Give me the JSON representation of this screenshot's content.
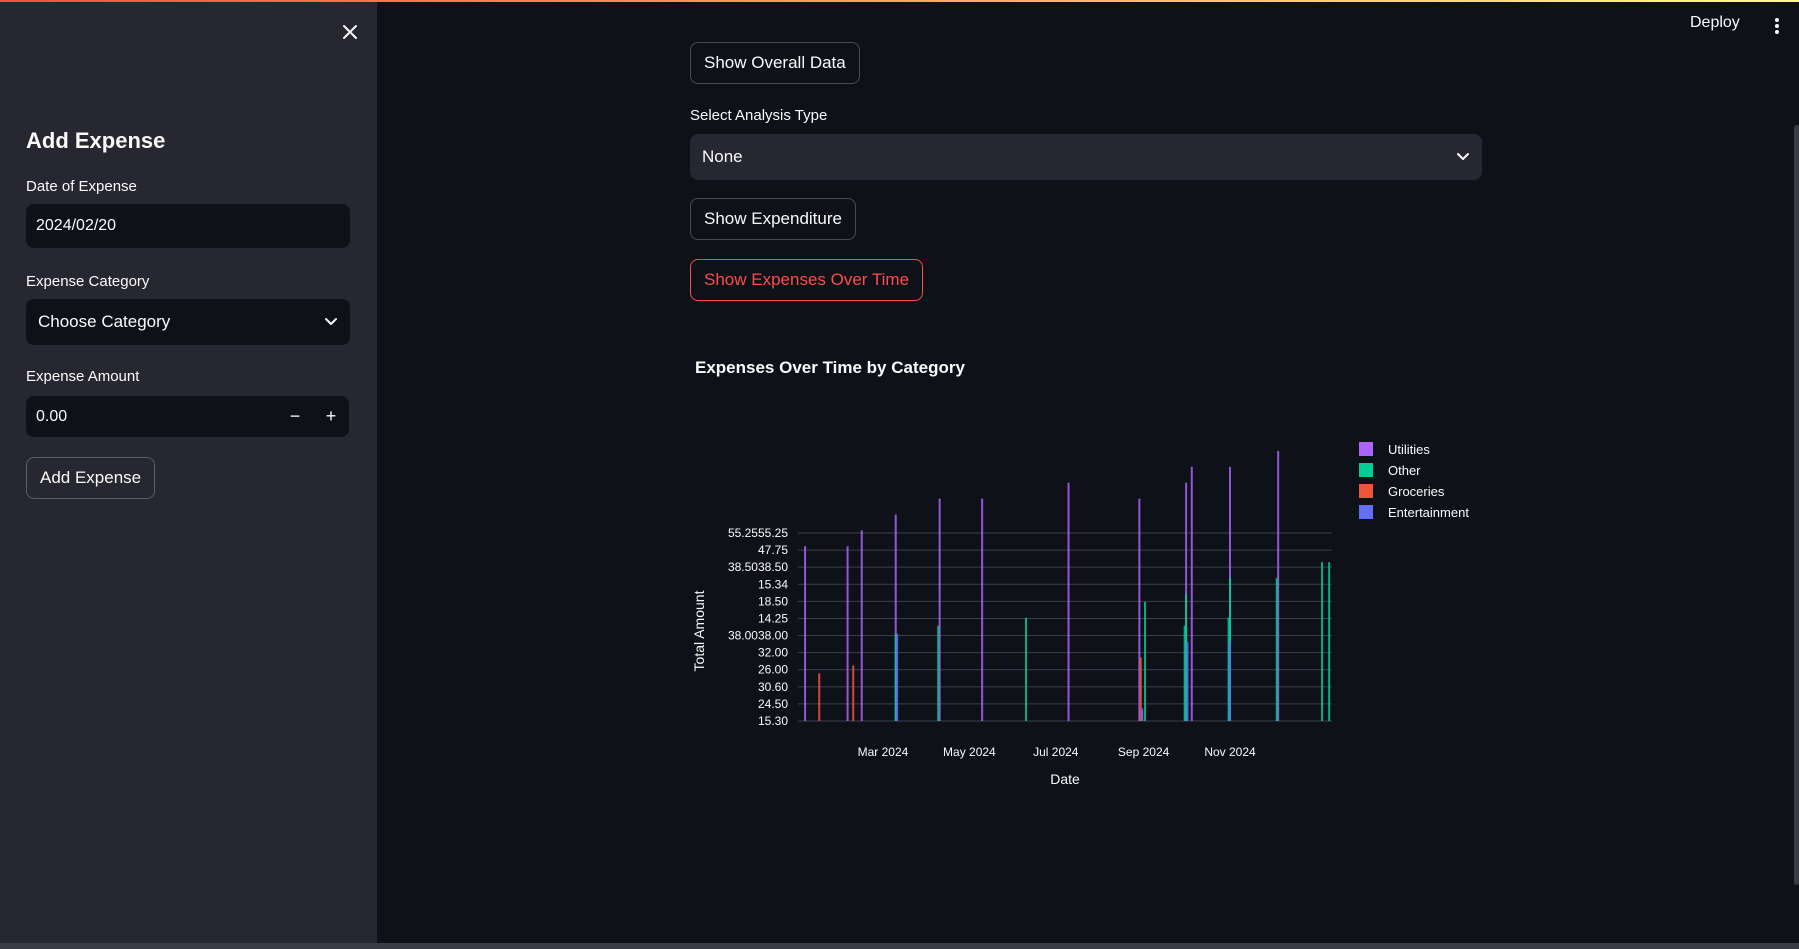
{
  "header": {
    "deploy_label": "Deploy"
  },
  "sidebar": {
    "title": "Add Expense",
    "date_label": "Date of Expense",
    "date_value": "2024/02/20",
    "category_label": "Expense Category",
    "category_value": "Choose Category",
    "amount_label": "Expense Amount",
    "amount_value": "0.00",
    "minus_label": "−",
    "plus_label": "+",
    "add_button_label": "Add Expense"
  },
  "main": {
    "show_overall_label": "Show Overall Data",
    "analysis_label": "Select Analysis Type",
    "analysis_value": "None",
    "show_expenditure_label": "Show Expenditure",
    "show_over_time_label": "Show Expenses Over Time"
  },
  "colors": {
    "accent": "#ff4b4b",
    "background": "#0e1117",
    "sidebar": "#262730",
    "utilities": "#ab63fa",
    "other": "#00cc96",
    "groceries": "#ef553b",
    "entertainment": "#636efa"
  },
  "chart_data": {
    "type": "bar",
    "title": "Expenses Over Time by Category",
    "xlabel": "Date",
    "ylabel": "Total Amount",
    "x_ticks": [
      "Mar 2024",
      "May 2024",
      "Jul 2024",
      "Sep 2024",
      "Nov 2024"
    ],
    "y_ticks": [
      "15.30",
      "24.50",
      "30.60",
      "26.00",
      "32.00",
      "38.0038.00",
      "14.25",
      "18.50",
      "15.34",
      "38.5038.50",
      "47.75",
      "55.2555.25"
    ],
    "legend_position": "right",
    "grid": true,
    "series": [
      {
        "name": "Utilities",
        "color": "#ab63fa",
        "points": [
          {
            "x": "2024-01-06",
            "y": 11
          },
          {
            "x": "2024-02-05",
            "y": 11
          },
          {
            "x": "2024-02-15",
            "y": 12
          },
          {
            "x": "2024-03-10",
            "y": 13
          },
          {
            "x": "2024-04-10",
            "y": 14
          },
          {
            "x": "2024-05-10",
            "y": 14
          },
          {
            "x": "2024-07-10",
            "y": 15
          },
          {
            "x": "2024-08-29",
            "y": 14
          },
          {
            "x": "2024-10-01",
            "y": 15
          },
          {
            "x": "2024-10-05",
            "y": 16
          },
          {
            "x": "2024-11-01",
            "y": 16
          },
          {
            "x": "2024-12-05",
            "y": 17
          }
        ]
      },
      {
        "name": "Other",
        "color": "#00cc96",
        "points": [
          {
            "x": "2024-03-10",
            "y": 5.5
          },
          {
            "x": "2024-04-09",
            "y": 6
          },
          {
            "x": "2024-06-10",
            "y": 6.5
          },
          {
            "x": "2024-09-02",
            "y": 7.5
          },
          {
            "x": "2024-09-30",
            "y": 6
          },
          {
            "x": "2024-10-01",
            "y": 8
          },
          {
            "x": "2024-10-31",
            "y": 6.5
          },
          {
            "x": "2024-11-01",
            "y": 9
          },
          {
            "x": "2024-12-04",
            "y": 9
          },
          {
            "x": "2025-01-05",
            "y": 10
          },
          {
            "x": "2025-01-10",
            "y": 10
          }
        ]
      },
      {
        "name": "Groceries",
        "color": "#ef553b",
        "points": [
          {
            "x": "2024-01-16",
            "y": 3
          },
          {
            "x": "2024-02-09",
            "y": 3.5
          },
          {
            "x": "2024-08-30",
            "y": 4
          },
          {
            "x": "2024-08-31",
            "y": 0.6
          }
        ]
      },
      {
        "name": "Entertainment",
        "color": "#636efa",
        "points": [
          {
            "x": "2024-03-11",
            "y": 5.5
          },
          {
            "x": "2024-08-31",
            "y": 0.8
          },
          {
            "x": "2024-10-02",
            "y": 5
          },
          {
            "x": "2024-11-01",
            "y": 5
          }
        ]
      }
    ]
  }
}
